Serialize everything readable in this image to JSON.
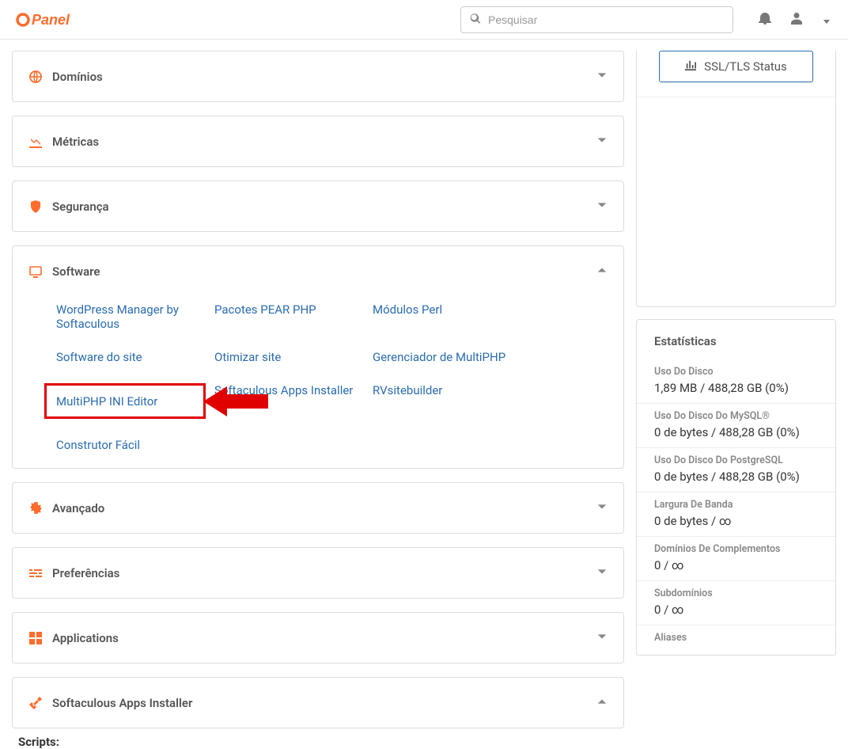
{
  "search": {
    "placeholder": "Pesquisar"
  },
  "ssl_button": "SSL/TLS Status",
  "panels": {
    "dominios": "Domínios",
    "metricas": "Métricas",
    "seguranca": "Segurança",
    "software": "Software",
    "avancado": "Avançado",
    "preferencias": "Preferências",
    "applications": "Applications",
    "softaculous": "Softaculous Apps Installer"
  },
  "software_links": {
    "wordpress": "WordPress Manager by Softaculous",
    "pear": "Pacotes PEAR PHP",
    "perl": "Módulos Perl",
    "sitesoftware": "Software do site",
    "optimize": "Otimizar site",
    "multiphp_mgr": "Gerenciador de MultiPHP",
    "multiphp_ini": "MultiPHP INI Editor",
    "softaculous_installer": "Softaculous Apps Installer",
    "rvsite": "RVsitebuilder",
    "construtor": "Construtor Fácil"
  },
  "scripts_label": "Scripts:",
  "stats": {
    "title": "Estatísticas",
    "disk": {
      "label": "Uso Do Disco",
      "value": "1,89 MB / 488,28 GB   (0%)"
    },
    "mysql": {
      "label": "Uso Do Disco Do MySQL®",
      "value": "0 de bytes / 488,28 GB   (0%)"
    },
    "pg": {
      "label": "Uso Do Disco Do PostgreSQL",
      "value": "0 de bytes / 488,28 GB   (0%)"
    },
    "band": {
      "label": "Largura De Banda",
      "value": "0 de bytes / ∞"
    },
    "addon": {
      "label": "Domínios De Complementos",
      "value": "0 / ∞"
    },
    "subd": {
      "label": "Subdomínios",
      "value": "0 / ∞"
    },
    "aliases": {
      "label": "Aliases",
      "value": ""
    }
  }
}
